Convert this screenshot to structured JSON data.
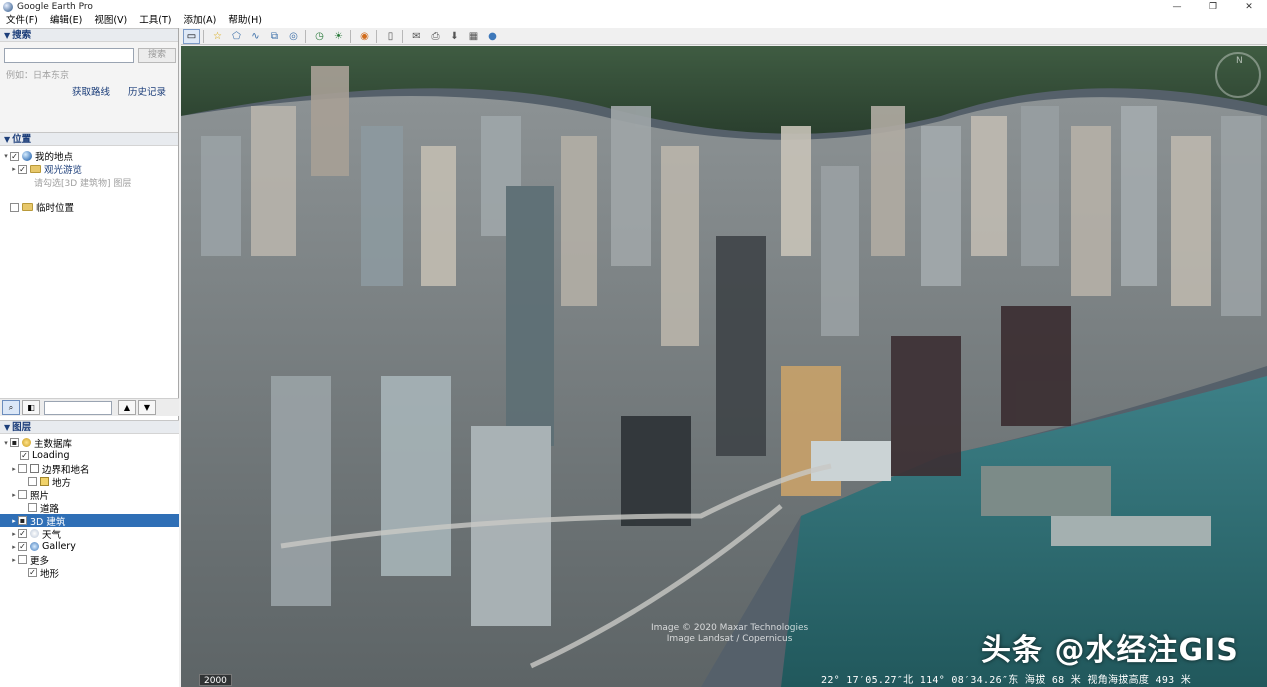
{
  "window": {
    "title": "Google Earth Pro",
    "controls": [
      "—",
      "❐",
      "✕"
    ]
  },
  "menu": [
    {
      "label": "文件(F)"
    },
    {
      "label": "编辑(E)"
    },
    {
      "label": "视图(V)"
    },
    {
      "label": "工具(T)"
    },
    {
      "label": "添加(A)"
    },
    {
      "label": "帮助(H)"
    }
  ],
  "search": {
    "header": "搜索",
    "button": "搜索",
    "hint": "例如：日本东京",
    "get_directions": "获取路线",
    "history": "历史记录"
  },
  "places": {
    "header": "位置",
    "my_places": "我的地点",
    "tour": "观光游览",
    "tour_hint": "请勾选[3D 建筑物] 图层",
    "temp_places": "临时位置"
  },
  "layers": {
    "header": "图层",
    "items": [
      {
        "label": "主数据库",
        "checked": false,
        "expand": "▾"
      },
      {
        "label": "Loading",
        "checked": true,
        "expand": ""
      },
      {
        "label": "边界和地名",
        "checked": false,
        "expand": "▸"
      },
      {
        "label": "地方",
        "checked": false,
        "expand": ""
      },
      {
        "label": "照片",
        "checked": false,
        "expand": "▸"
      },
      {
        "label": "道路",
        "checked": false,
        "expand": ""
      },
      {
        "label": "3D 建筑",
        "checked": false,
        "expand": "▸",
        "selected": true
      },
      {
        "label": "天气",
        "checked": true,
        "expand": "▸"
      },
      {
        "label": "Gallery",
        "checked": true,
        "expand": "▸"
      },
      {
        "label": "更多",
        "checked": false,
        "expand": "▸"
      },
      {
        "label": "地形",
        "checked": true,
        "expand": ""
      }
    ]
  },
  "map": {
    "copyright_line1": "Image © 2020 Maxar Technologies",
    "copyright_line2": "Image Landsat / Copernicus",
    "year": "2000",
    "status": "22° 17′05.27″北 114° 08′34.26″东 海拔    68 米   视角海拔高度    493 米",
    "watermark": "头条 @水经注GIS"
  },
  "colors": {
    "selected": "#2f6fb6",
    "header_text": "#1c3e7a",
    "water": "#2e6f73"
  }
}
